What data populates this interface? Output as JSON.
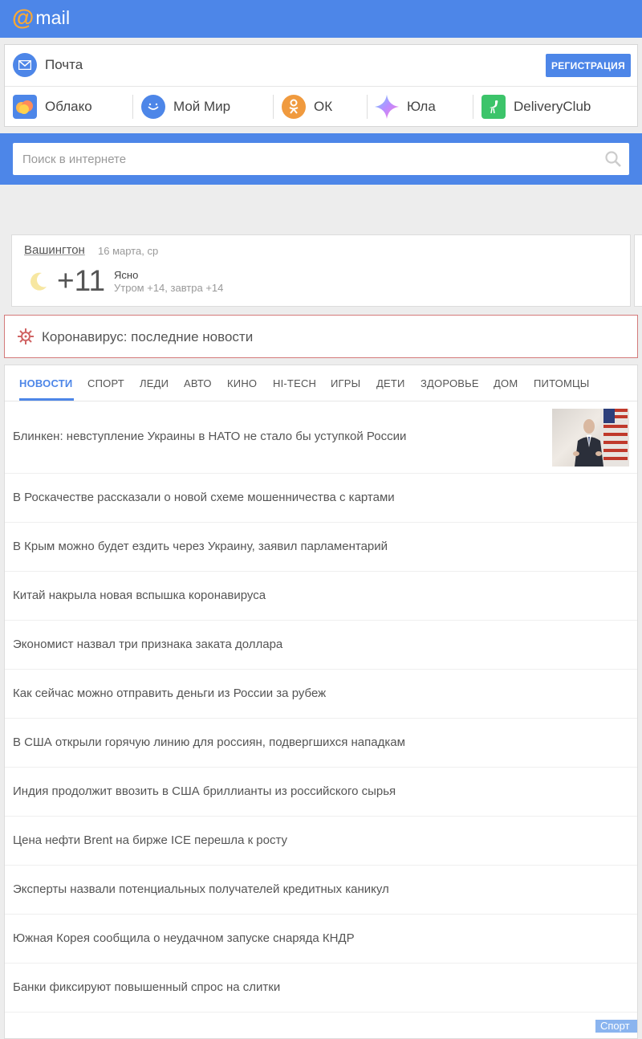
{
  "header": {
    "logo_at": "@",
    "logo_text": "mail"
  },
  "services": {
    "mail_label": "Почта",
    "register_button": "РЕГИСТРАЦИЯ",
    "items": [
      {
        "label": "Облако",
        "icon": "cloud-icon"
      },
      {
        "label": "Мой Мир",
        "icon": "smile-icon"
      },
      {
        "label": "ОК",
        "icon": "ok-icon"
      },
      {
        "label": "Юла",
        "icon": "star-icon"
      },
      {
        "label": "DeliveryClub",
        "icon": "ostrich-icon"
      }
    ]
  },
  "search": {
    "placeholder": "Поиск в интернете"
  },
  "weather": {
    "city": "Вашингтон",
    "date": "16 марта, ср",
    "temperature": "+11",
    "condition": "Ясно",
    "forecast": "Утром +14, завтра +14"
  },
  "corona": {
    "text": "Коронавирус: последние новости"
  },
  "news": {
    "tabs": [
      "НОВОСТИ",
      "СПОРТ",
      "ЛЕДИ",
      "АВТО",
      "КИНО",
      "HI-TECH",
      "ИГРЫ",
      "ДЕТИ",
      "ЗДОРОВЬЕ",
      "ДОМ",
      "ПИТОМЦЫ"
    ],
    "active_tab": "НОВОСТИ",
    "items": [
      "Блинкен: невступление Украины в НАТО не стало бы уступкой России",
      "В Роскачестве рассказали о новой схеме мошенничества с картами",
      "В Крым можно будет ездить через Украину, заявил парламентарий",
      "Китай накрыла новая вспышка коронавируса",
      "Экономист назвал три признака заката доллара",
      "Как сейчас можно отправить деньги из России за рубеж",
      "В США открыли горячую линию для россиян, подвергшихся нападкам",
      "Индия продолжит ввозить в США бриллианты из российского сырья",
      "Цена нефти Brent на бирже ICE перешла к росту",
      "Эксперты назвали потенциальных получателей кредитных каникул",
      "Южная Корея сообщила о неудачном запуске снаряда КНДР",
      "Банки фиксируют повышенный спрос на слитки"
    ],
    "sport_badge": "Спорт"
  },
  "colors": {
    "brand_blue": "#4d86e8",
    "logo_orange": "#ffa930",
    "corona_border": "#d47a7a"
  }
}
